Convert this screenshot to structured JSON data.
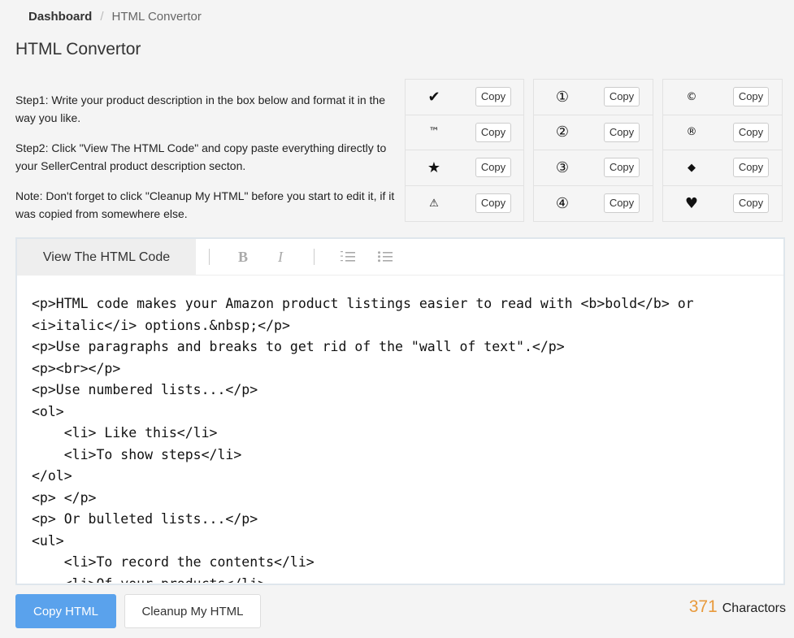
{
  "breadcrumb": {
    "root": "Dashboard",
    "separator": "/",
    "current": "HTML Convertor"
  },
  "page_title": "HTML Convertor",
  "instructions": {
    "step1": "Step1: Write your product description in the box below and format it in the way you like.",
    "step2": "Step2: Click \"View The HTML Code\" and copy paste everything directly to your SellerCentral product description secton.",
    "note": "Note: Don't forget to click \"Cleanup My HTML\" before you start to edit it, if it was copied from somewhere else."
  },
  "copy_label": "Copy",
  "symbol_groups": [
    [
      {
        "symbol": "✔",
        "icon": "checkmark-icon"
      },
      {
        "symbol": "™",
        "icon": "trademark-icon"
      },
      {
        "symbol": "★",
        "icon": "star-icon"
      },
      {
        "symbol": "⚠",
        "icon": "warning-icon"
      }
    ],
    [
      {
        "symbol": "①",
        "icon": "circled-one-icon"
      },
      {
        "symbol": "②",
        "icon": "circled-two-icon"
      },
      {
        "symbol": "③",
        "icon": "circled-three-icon"
      },
      {
        "symbol": "④",
        "icon": "circled-four-icon"
      }
    ],
    [
      {
        "symbol": "©",
        "icon": "copyright-icon"
      },
      {
        "symbol": "®",
        "icon": "registered-icon"
      },
      {
        "symbol": "◆",
        "icon": "diamond-icon"
      },
      {
        "symbol": "♥",
        "icon": "heart-icon"
      }
    ]
  ],
  "editor": {
    "view_html_tab": "View The HTML Code",
    "toolbar": {
      "bold": "B",
      "italic": "I"
    },
    "code_lines": [
      "<p>HTML code makes your Amazon product listings easier to read with <b>bold</b> or",
      "<i>italic</i> options.&nbsp;</p>",
      "<p>Use paragraphs and breaks to get rid of the \"wall of text\".</p>",
      "<p><br></p>",
      "<p>Use numbered lists...</p>",
      "<ol>",
      "    <li> Like this</li>",
      "    <li>To show steps</li>",
      "</ol>",
      "<p> </p>",
      "<p> Or bulleted lists...</p>",
      "<ul>",
      "    <li>To record the contents</li>",
      "    <li>Of your products</li>"
    ]
  },
  "actions": {
    "copy_html": "Copy HTML",
    "cleanup": "Cleanup My HTML"
  },
  "char_count": {
    "value": "371",
    "label": "Charactors"
  },
  "colors": {
    "primary": "#5aa2ec",
    "count_accent": "#e89a3c"
  }
}
